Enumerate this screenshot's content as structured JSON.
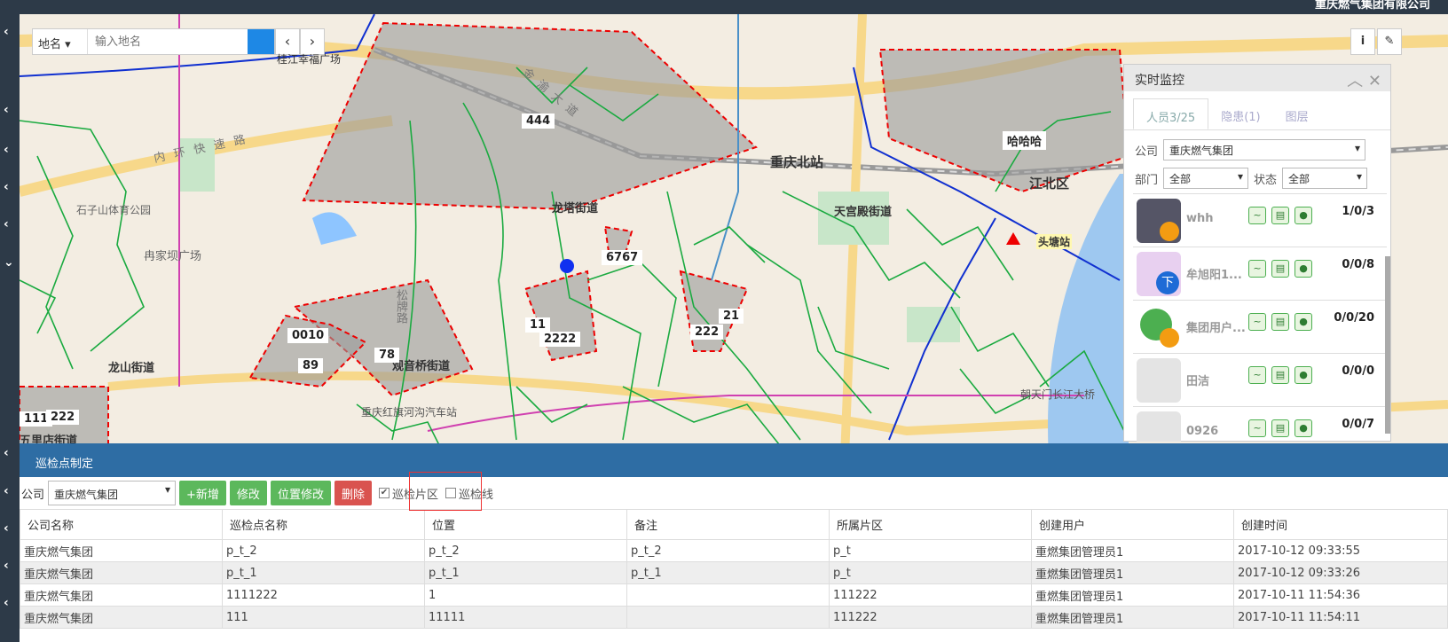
{
  "topbar": {
    "title": "重庆燃气集团有限公司"
  },
  "search": {
    "type_label": "地名",
    "placeholder": "输入地名"
  },
  "map": {
    "place_labels": [
      "桂江幸福广场",
      "内环快速路",
      "龙塔街道",
      "天宫殿街道",
      "重庆北站",
      "江北区",
      "头塘站",
      "冉家坝广场",
      "石子山体育公园",
      "龙山街道",
      "观音桥街道",
      "重庆红旗河沟汽车站",
      "朝天门长江大桥",
      "五里店街道",
      "金渝大道",
      "松牌路"
    ],
    "numeric_labels": [
      "444",
      "哈哈哈",
      "6767",
      "21",
      "222",
      "0010",
      "89",
      "78",
      "11",
      "2222",
      "111",
      "222"
    ]
  },
  "monitor": {
    "title": "实时监控",
    "tabs": [
      "人员3/25",
      "隐患(1)",
      "图层"
    ],
    "company_label": "公司",
    "company_value": "重庆燃气集团",
    "dept_label": "部门",
    "dept_value": "全部",
    "status_label": "状态",
    "status_value": "全部",
    "people": [
      {
        "name": "whh",
        "count": "1/0/3"
      },
      {
        "name": "牟旭阳1...",
        "count": "0/0/8"
      },
      {
        "name": "集团用户...",
        "count": "0/0/20"
      },
      {
        "name": "田洁",
        "count": "0/0/0"
      },
      {
        "name": "0926",
        "count": "0/0/7"
      }
    ]
  },
  "panel": {
    "title": "巡检点制定",
    "company_label": "公司",
    "company_value": "重庆燃气集团",
    "buttons": {
      "add": "+新增",
      "edit": "修改",
      "pos_edit": "位置修改",
      "delete": "删除"
    },
    "chk_area": "巡检片区",
    "chk_line": "巡检线",
    "columns": [
      "公司名称",
      "巡检点名称",
      "位置",
      "备注",
      "所属片区",
      "创建用户",
      "创建时间"
    ],
    "rows": [
      [
        "重庆燃气集团",
        "p_t_2",
        "p_t_2",
        "p_t_2",
        "p_t",
        "重燃集团管理员1",
        "2017-10-12 09:33:55"
      ],
      [
        "重庆燃气集团",
        "p_t_1",
        "p_t_1",
        "p_t_1",
        "p_t",
        "重燃集团管理员1",
        "2017-10-12 09:33:26"
      ],
      [
        "重庆燃气集团",
        "1111222",
        "1",
        "",
        "111222",
        "重燃集团管理员1",
        "2017-10-11 11:54:36"
      ],
      [
        "重庆燃气集团",
        "111",
        "11111",
        "",
        "111222",
        "重燃集团管理员1",
        "2017-10-11 11:54:11"
      ]
    ]
  }
}
